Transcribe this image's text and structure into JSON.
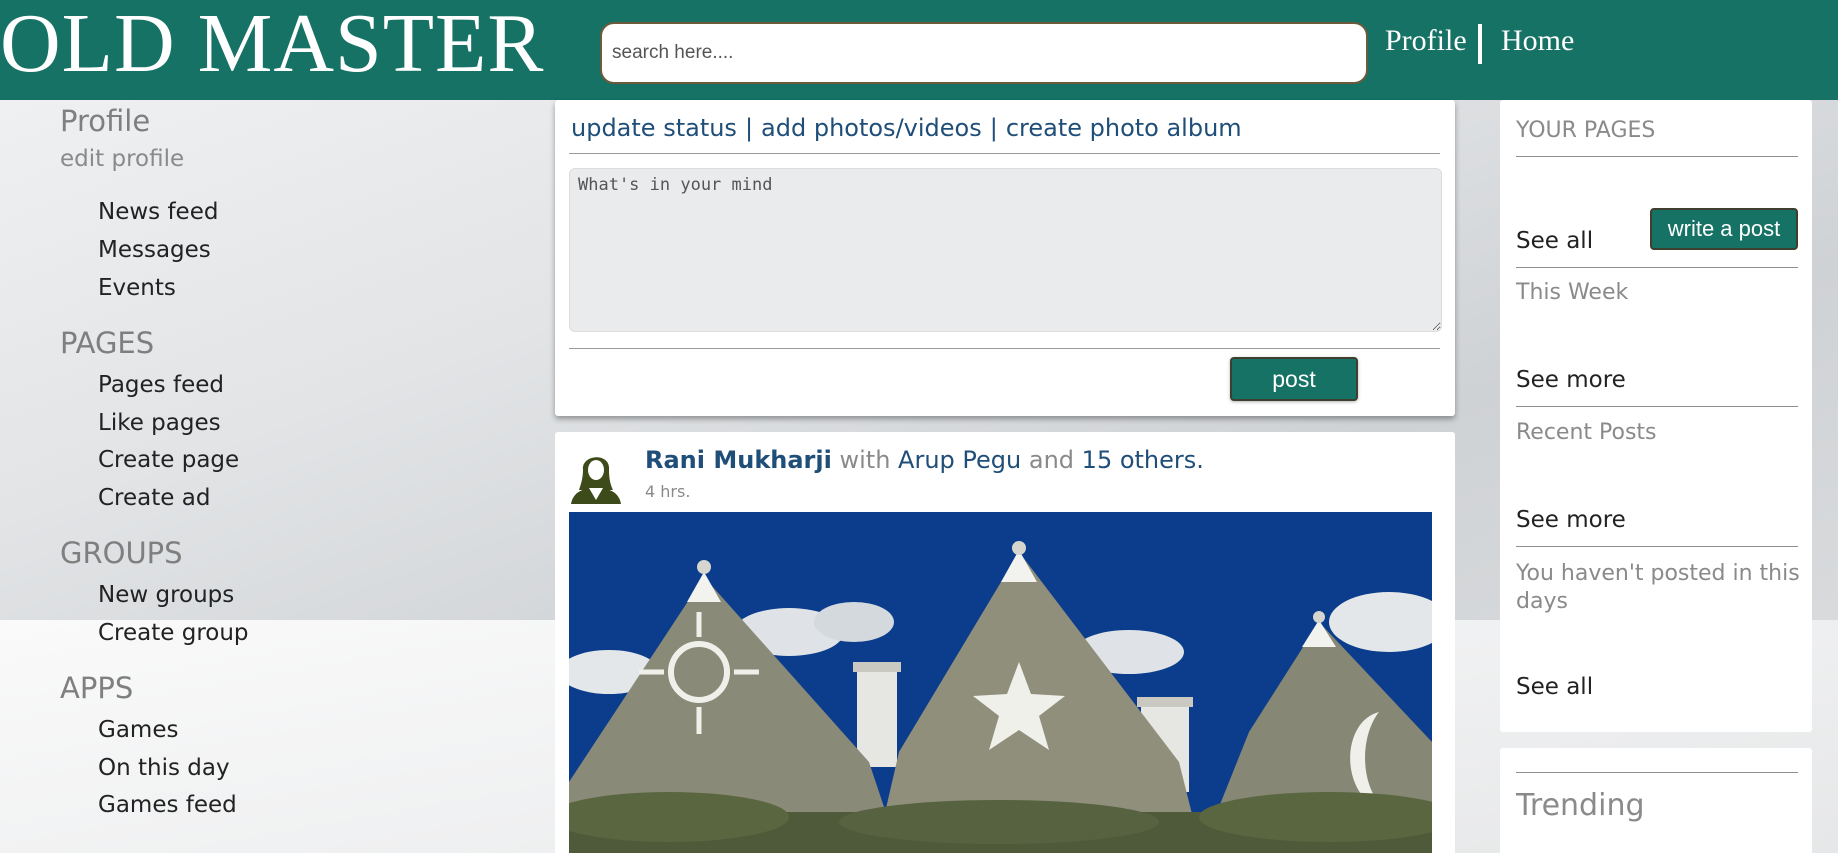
{
  "header": {
    "logo": "OLD MASTER",
    "search_placeholder": "search here....",
    "nav": [
      "Profile",
      "Home"
    ]
  },
  "left_sidebar": {
    "profile_title": "Profile",
    "edit_profile": "edit profile",
    "profile_items": [
      "News feed",
      "Messages",
      "Events"
    ],
    "pages_title": "PAGES",
    "pages_items": [
      "Pages feed",
      "Like pages",
      "Create page",
      "Create ad"
    ],
    "groups_title": "GROUPS",
    "groups_items": [
      "New groups",
      "Create group"
    ],
    "apps_title": "APPS",
    "apps_items": [
      "Games",
      "On this day",
      "Games feed"
    ]
  },
  "composer": {
    "tabs": [
      "update status",
      "add photos/videos",
      "create photo album"
    ],
    "placeholder": "What's in your mind",
    "post_label": "post"
  },
  "feed_post": {
    "author": "Rani Mukharji",
    "with_text": "with",
    "tagged": "Arup Pegu",
    "and_text": "and",
    "others": "15 others.",
    "time": "4 hrs."
  },
  "right_sidebar": {
    "your_pages": "YOUR PAGES",
    "see_all_1": "See all",
    "write_post_label": "write a post",
    "this_week": "This Week",
    "see_more_1": "See more",
    "recent_posts": "Recent Posts",
    "see_more_2": "See more",
    "not_posted": "You haven't posted in this days",
    "see_all_2": "See all",
    "trending": "Trending"
  },
  "colors": {
    "brand": "#157265",
    "link": "#1f4e79",
    "sky": "#0b3d8c"
  }
}
